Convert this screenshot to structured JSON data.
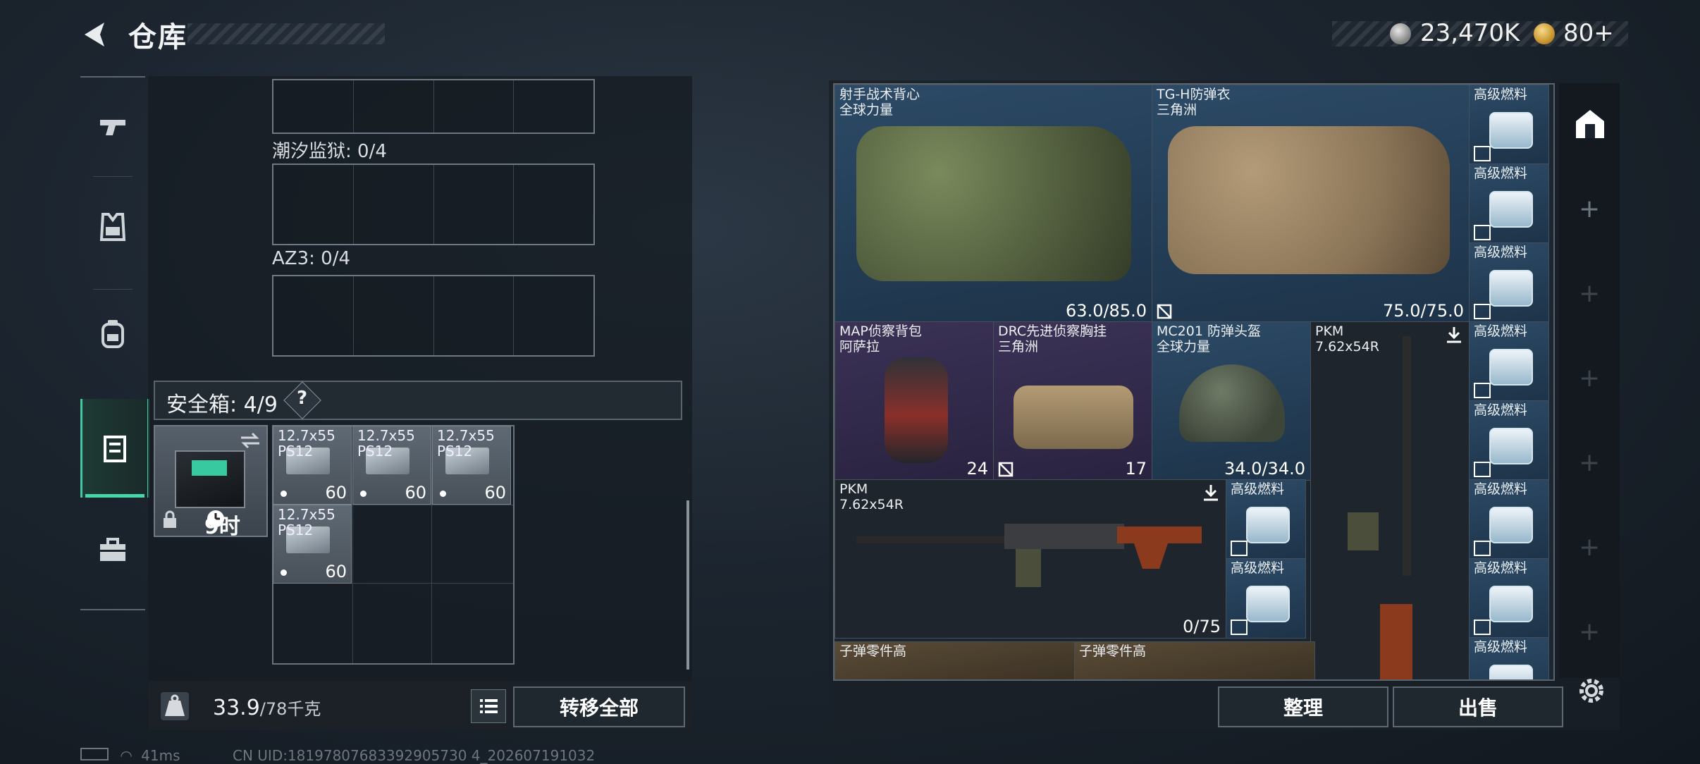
{
  "header": {
    "title": "仓库",
    "currency": {
      "silver": "23,470K",
      "gold": "80+"
    }
  },
  "left_nav": {
    "items": [
      "weapon-icon",
      "vest-icon",
      "backpack-icon",
      "safe-box-icon",
      "toolbox-icon"
    ],
    "active_index": 3
  },
  "left_panel": {
    "sections": [
      {
        "label": "潮汐监狱: 0/4"
      },
      {
        "label": "AZ3: 0/4"
      }
    ],
    "safe_box": {
      "title": "安全箱: 4/9",
      "help": "?",
      "timer": "9时"
    },
    "ammo_items": [
      {
        "name": "12.7x55\nPS12",
        "count": "60"
      },
      {
        "name": "12.7x55\nPS12",
        "count": "60"
      },
      {
        "name": "12.7x55\nPS12",
        "count": "60"
      },
      {
        "name": "12.7x55\nPS12",
        "count": "60"
      }
    ],
    "weight": {
      "current": "33.9",
      "max": "/78千克"
    },
    "transfer_all": "转移全部"
  },
  "stash": {
    "items": [
      {
        "name": "射手战术背心\n全球力量",
        "value": "63.0/85.0"
      },
      {
        "name": "TG-H防弹衣\n三角洲",
        "value": "75.0/75.0"
      },
      {
        "name": "MAP侦察背包\n阿萨拉",
        "value": "24"
      },
      {
        "name": "DRC先进侦察胸挂\n三角洲",
        "value": "17"
      },
      {
        "name": "MC201 防弹头盔\n全球力量",
        "value": "34.0/34.0"
      },
      {
        "name": "PKM\n7.62x54R",
        "value": ""
      },
      {
        "name": "PKM\n7.62x54R",
        "value": "0/75"
      },
      {
        "name": "子弹零件高",
        "value": ""
      },
      {
        "name": "子弹零件高",
        "value": ""
      }
    ],
    "fuel_label": "高级燃料",
    "buttons": {
      "sort": "整理",
      "sell": "出售"
    }
  },
  "status": {
    "ping": "41ms",
    "uid": "CN UID:18197807683392905730 4_202607191032"
  },
  "colors": {
    "accent_green": "#47d6a8",
    "rarity_blue": "#2c4a66",
    "rarity_purple": "#3b3256",
    "rarity_gold": "#5a4b36"
  }
}
